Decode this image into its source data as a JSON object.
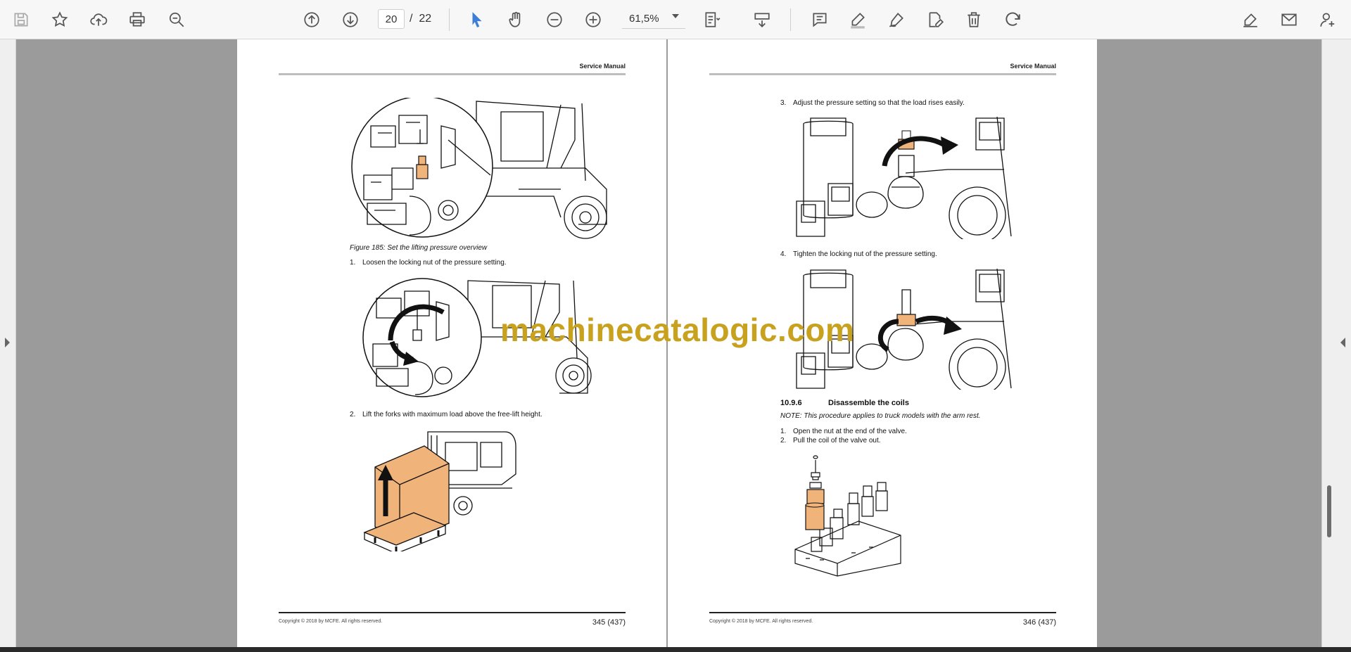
{
  "toolbar": {
    "current_page": "20",
    "page_separator": "/",
    "total_pages": "22",
    "zoom": "61,5%"
  },
  "colors": {
    "accent": "#3d7fd6",
    "highlight_orange": "#f0b47a",
    "watermark": "#c8a21e"
  },
  "watermark": "machinecatalogic.com",
  "left_page": {
    "header": "Service Manual",
    "figure_caption": "Figure 185: Set the lifting pressure overview",
    "step1_num": "1.",
    "step1_text": "Loosen the locking nut of the pressure setting.",
    "step2_num": "2.",
    "step2_text": "Lift the forks with maximum load above the free-lift height.",
    "copyright": "Copyright © 2018 by MCFE. All rights reserved.",
    "page_number": "345 (437)"
  },
  "right_page": {
    "header": "Service Manual",
    "step3_num": "3.",
    "step3_text": "Adjust the pressure setting so that the load rises easily.",
    "step4_num": "4.",
    "step4_text": "Tighten the locking nut of the pressure setting.",
    "section_number": "10.9.6",
    "section_title": "Disassemble the coils",
    "note": "NOTE: This procedure applies to truck models with the arm rest.",
    "stepA_num": "1.",
    "stepA_text": "Open the nut at the end of the valve.",
    "stepB_num": "2.",
    "stepB_text": "Pull the coil of the valve out.",
    "copyright": "Copyright © 2018 by MCFE. All rights reserved.",
    "page_number": "346 (437)"
  }
}
